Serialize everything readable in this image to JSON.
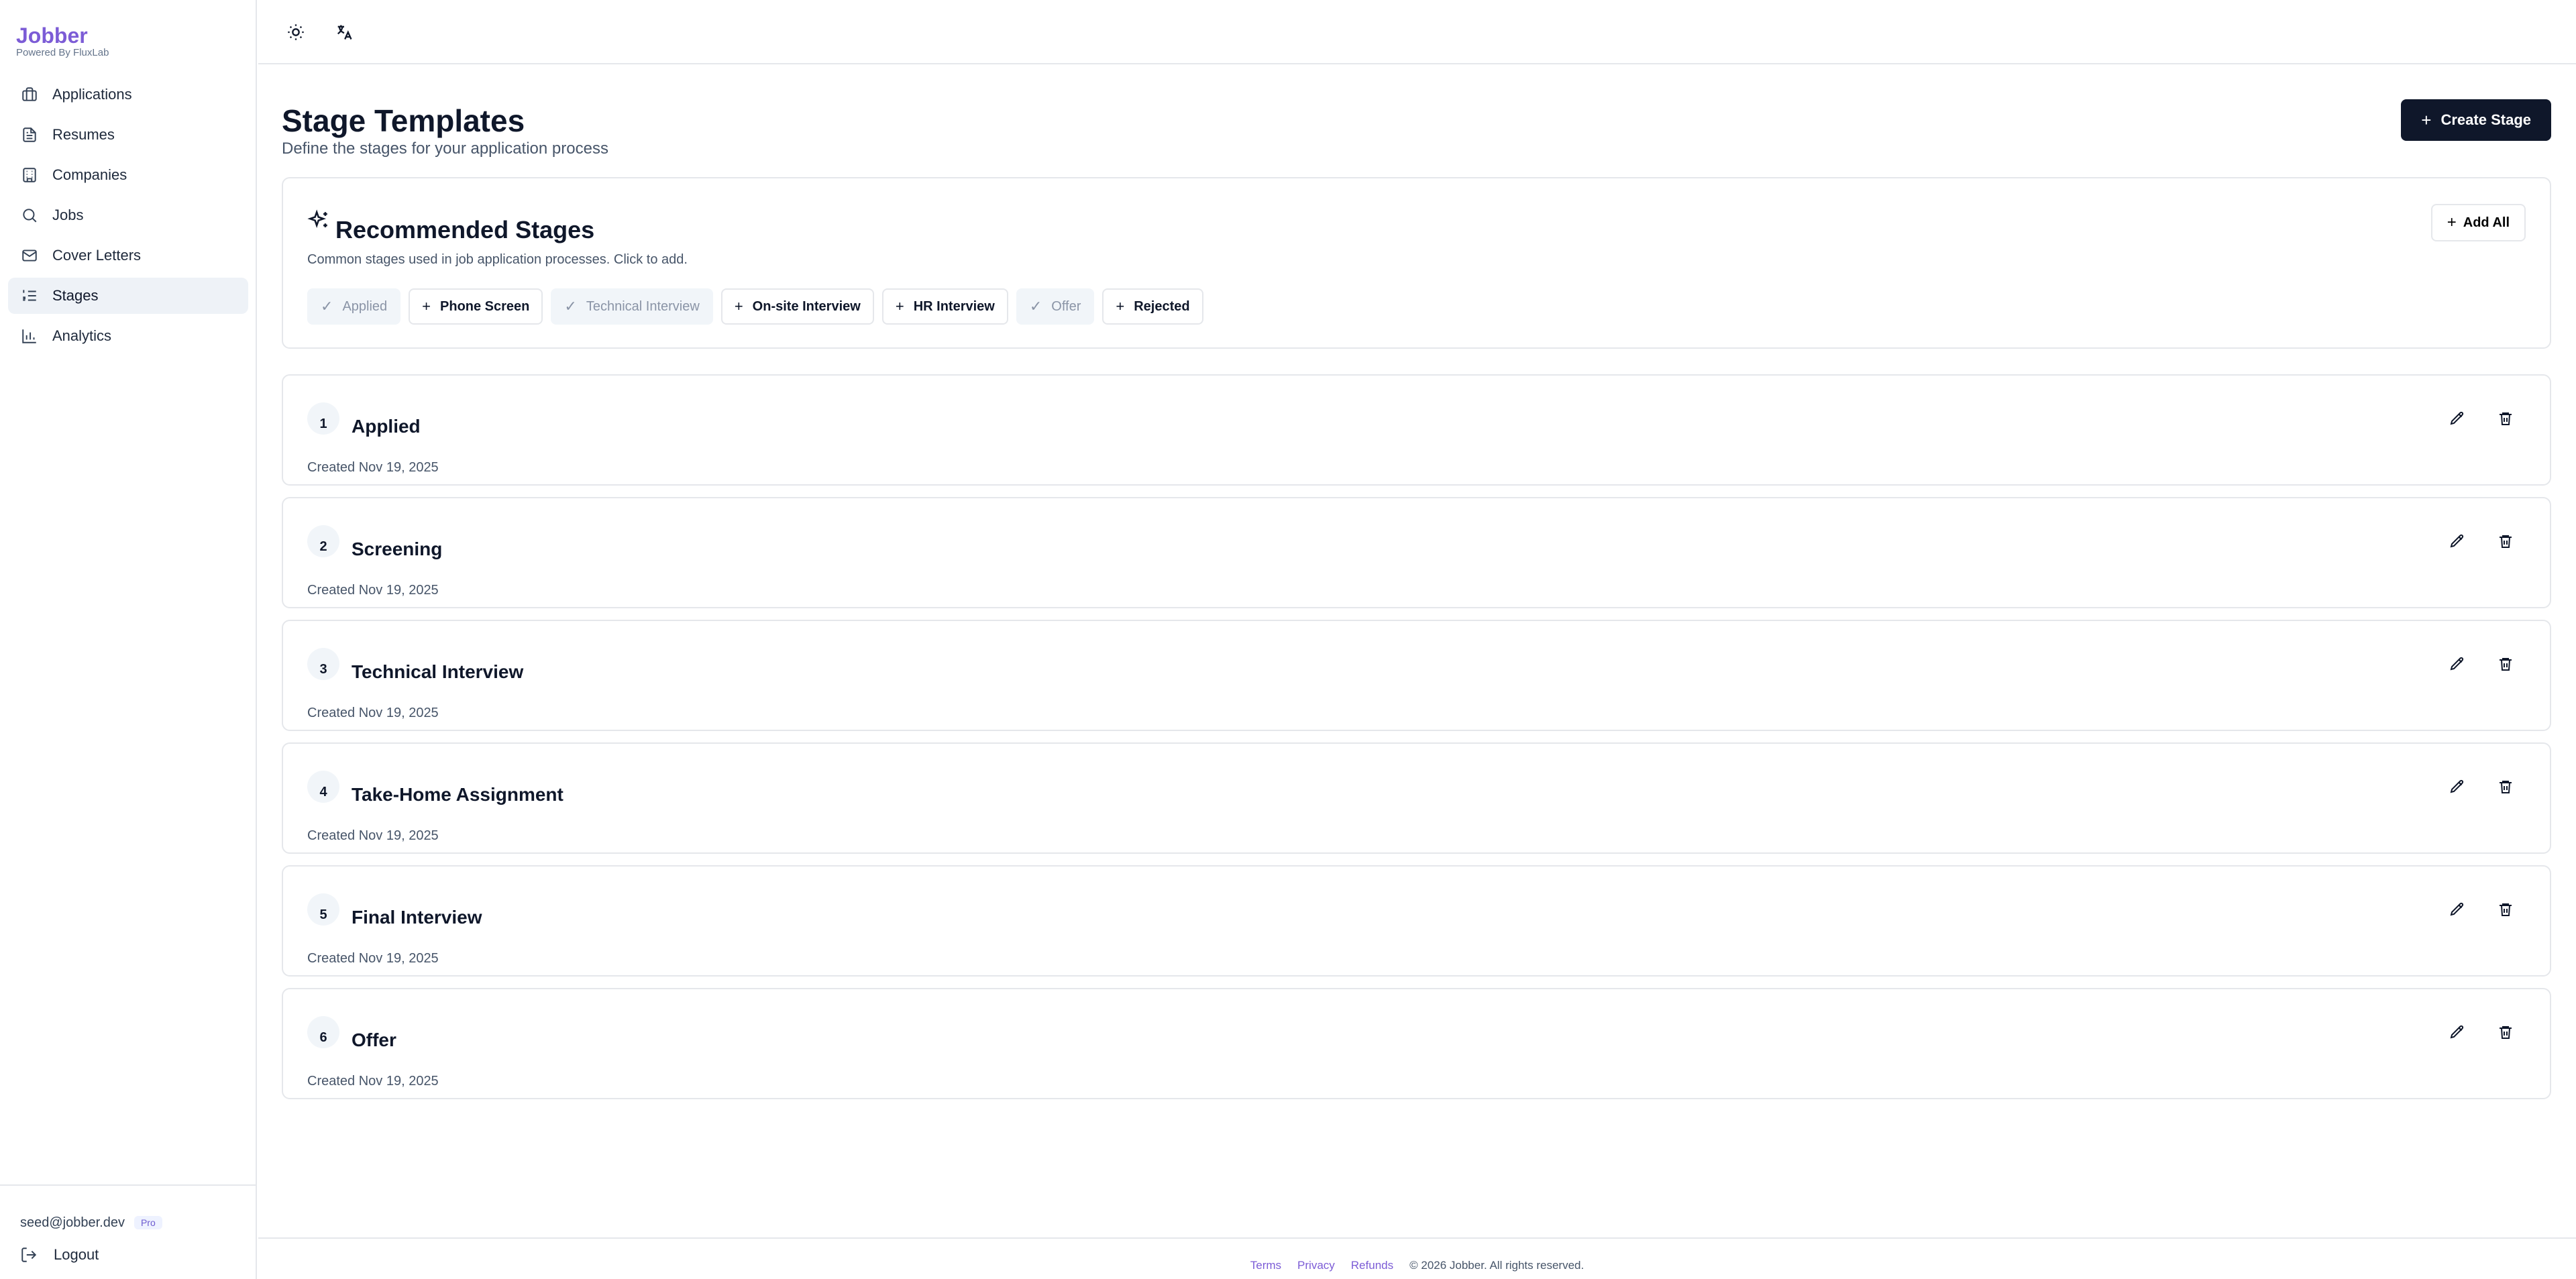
{
  "brand": {
    "name": "Jobber",
    "subtitle": "Powered By FluxLab"
  },
  "sidebar": {
    "items": [
      {
        "label": "Applications",
        "icon": "briefcase-icon"
      },
      {
        "label": "Resumes",
        "icon": "document-icon"
      },
      {
        "label": "Companies",
        "icon": "building-icon"
      },
      {
        "label": "Jobs",
        "icon": "search-icon"
      },
      {
        "label": "Cover Letters",
        "icon": "mail-icon"
      },
      {
        "label": "Stages",
        "icon": "list-ordered-icon",
        "active": true
      },
      {
        "label": "Analytics",
        "icon": "bar-chart-icon"
      }
    ],
    "user_email": "seed@jobber.dev",
    "plan_badge": "Pro",
    "logout_label": "Logout"
  },
  "header": {
    "theme_icon": "sun-icon",
    "language_icon": "translate-icon"
  },
  "page": {
    "title": "Stage Templates",
    "subtitle": "Define the stages for your application process",
    "create_button": "Create Stage"
  },
  "recommended": {
    "title": "Recommended Stages",
    "subtitle": "Common stages used in job application processes. Click to add.",
    "add_all_label": "Add All",
    "chips": [
      {
        "label": "Applied",
        "added": true
      },
      {
        "label": "Phone Screen",
        "added": false
      },
      {
        "label": "Technical Interview",
        "added": true
      },
      {
        "label": "On-site Interview",
        "added": false
      },
      {
        "label": "HR Interview",
        "added": false
      },
      {
        "label": "Offer",
        "added": true
      },
      {
        "label": "Rejected",
        "added": false
      }
    ]
  },
  "stages": [
    {
      "number": "1",
      "name": "Applied",
      "created": "Created Nov 19, 2025"
    },
    {
      "number": "2",
      "name": "Screening",
      "created": "Created Nov 19, 2025"
    },
    {
      "number": "3",
      "name": "Technical Interview",
      "created": "Created Nov 19, 2025"
    },
    {
      "number": "4",
      "name": "Take-Home Assignment",
      "created": "Created Nov 19, 2025"
    },
    {
      "number": "5",
      "name": "Final Interview",
      "created": "Created Nov 19, 2025"
    },
    {
      "number": "6",
      "name": "Offer",
      "created": "Created Nov 19, 2025"
    }
  ],
  "footer": {
    "links": [
      "Terms",
      "Privacy",
      "Refunds"
    ],
    "copyright": "© 2026 Jobber. All rights reserved."
  },
  "colors": {
    "brand": "#7c5cd6",
    "primary_button": "#0f172a",
    "active_nav": "#eef2f7"
  }
}
